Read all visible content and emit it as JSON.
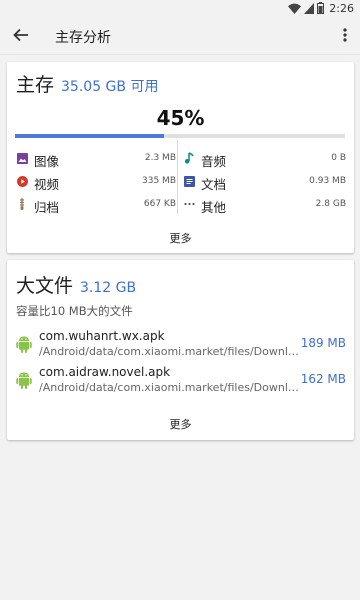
{
  "status_bar": {
    "time": "2:26",
    "icons": [
      "wifi-icon",
      "signal-icon",
      "battery-icon"
    ]
  },
  "app_bar": {
    "title": "主存分析",
    "back_icon": "arrow-left-icon",
    "menu_icon": "more-vert-icon"
  },
  "storage": {
    "title": "主存",
    "available": "35.05 GB 可用",
    "percent": "45%",
    "used_fraction": 0.45,
    "categories": [
      {
        "label": "图像",
        "size": "2.3 MB",
        "icon": "image-icon",
        "color": "#7b3fa0"
      },
      {
        "label": "音频",
        "size": "0 B",
        "icon": "music-note-icon",
        "color": "#0f8f7a"
      },
      {
        "label": "视频",
        "size": "335 MB",
        "icon": "video-icon",
        "color": "#d63a2c"
      },
      {
        "label": "文档",
        "size": "0.93 MB",
        "icon": "document-icon",
        "color": "#3f55a8"
      },
      {
        "label": "归档",
        "size": "667 KB",
        "icon": "archive-icon",
        "color": "#8a7a55"
      },
      {
        "label": "其他",
        "size": "2.8 GB",
        "icon": "ellipsis-icon",
        "color": "#555555"
      }
    ],
    "more_label": "更多"
  },
  "large_files": {
    "title": "大文件",
    "total": "3.12 GB",
    "description": "容量比10 MB大的文件",
    "files": [
      {
        "name": "com.wuhanrt.wx.apk",
        "path": "/Android/data/com.xiaomi.market/files/Download/",
        "size": "189 MB"
      },
      {
        "name": "com.aidraw.novel.apk",
        "path": "/Android/data/com.xiaomi.market/files/Download/",
        "size": "162 MB"
      }
    ],
    "more_label": "更多"
  },
  "colors": {
    "accent": "#3f6fd0",
    "progress": "#4d79d8",
    "android": "#8bc34a"
  }
}
